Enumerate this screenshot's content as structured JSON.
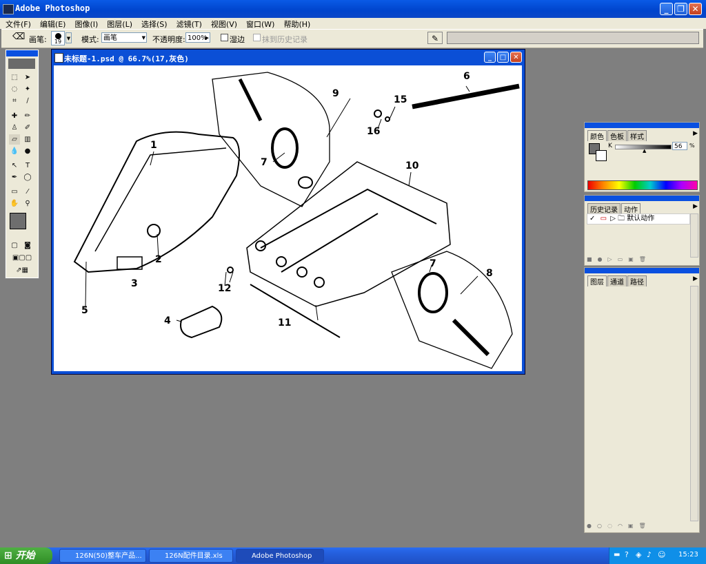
{
  "app": {
    "title": "Adobe Photoshop"
  },
  "menu": [
    "文件(F)",
    "编辑(E)",
    "图像(I)",
    "图层(L)",
    "选择(S)",
    "滤镜(T)",
    "视图(V)",
    "窗口(W)",
    "帮助(H)"
  ],
  "options": {
    "brush_label": "画笔:",
    "brush_size": "19",
    "mode_label": "模式:",
    "mode_value": "画笔",
    "opacity_label": "不透明度:",
    "opacity_value": "100%",
    "wet_edges": "湿边",
    "erase_history": "抹到历史记录"
  },
  "document": {
    "title": "未标题-1.psd @ 66.7%(17,灰色)"
  },
  "callouts": [
    "1",
    "2",
    "3",
    "4",
    "5",
    "6",
    "7",
    "7",
    "8",
    "9",
    "10",
    "11",
    "12",
    "15",
    "16"
  ],
  "color_panel": {
    "tabs": [
      "颜色",
      "色板",
      "样式"
    ],
    "channel": "K",
    "value": "56",
    "unit": "%"
  },
  "history_panel": {
    "tabs": [
      "历史记录",
      "动作"
    ],
    "item": "默认动作"
  },
  "layers_panel": {
    "tabs": [
      "图层",
      "通道",
      "路径"
    ]
  },
  "taskbar": {
    "start": "开始",
    "tasks": [
      "126N(50)整车产品...",
      "126N配件目录.xls",
      "Adobe Photoshop"
    ],
    "clock": "15:23"
  },
  "colors": {
    "xp_blue": "#0a50e0",
    "panel_bg": "#ece9d8",
    "workspace": "#7f7f7f"
  }
}
